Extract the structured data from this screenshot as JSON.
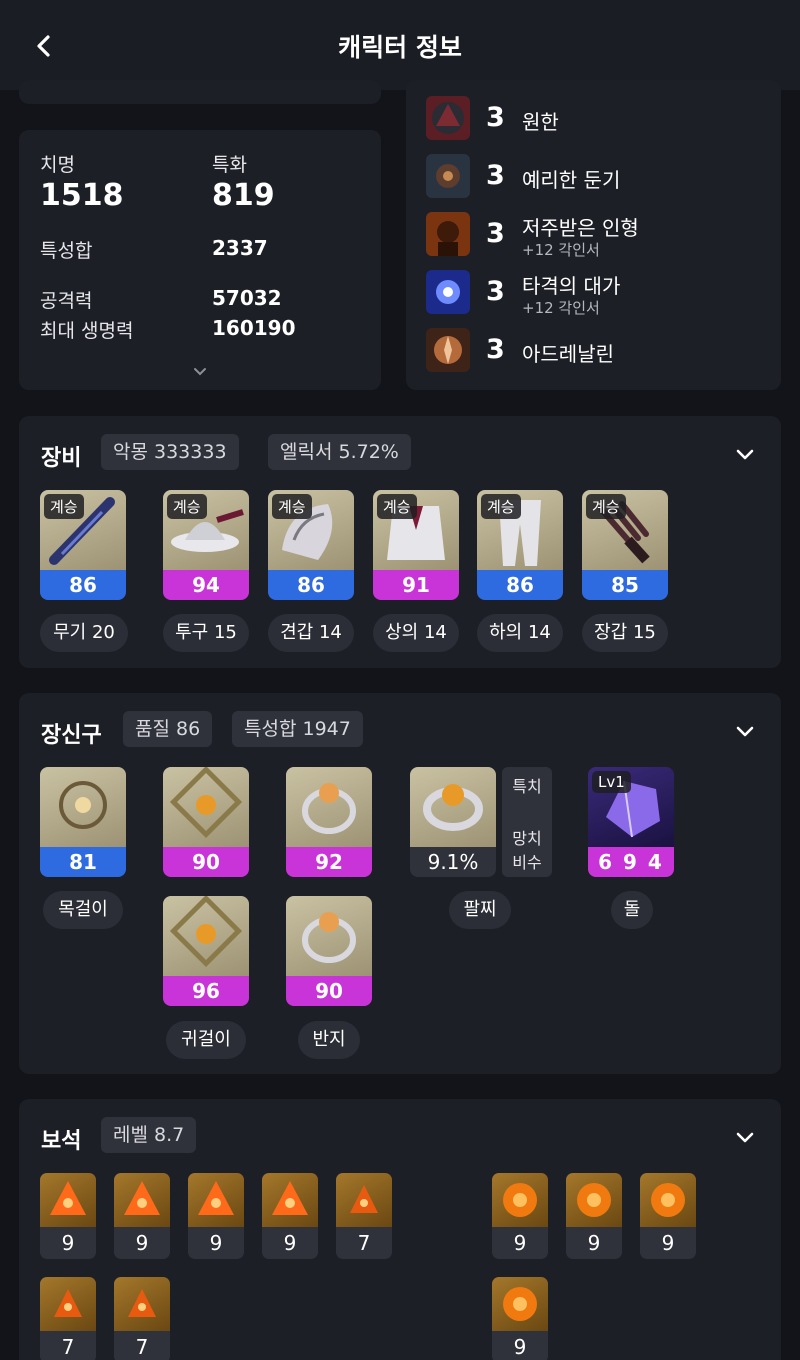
{
  "header": {
    "title": "캐릭터 정보"
  },
  "stats": {
    "crit_label": "치명",
    "crit_value": "1518",
    "spec_label": "특화",
    "spec_value": "819",
    "sum_label": "특성합",
    "sum_value": "2337",
    "atk_label": "공격력",
    "atk_value": "57032",
    "hp_label": "최대 생명력",
    "hp_value": "160190"
  },
  "engravings": [
    {
      "level": "3",
      "name": "원한",
      "sub": ""
    },
    {
      "level": "3",
      "name": "예리한 둔기",
      "sub": ""
    },
    {
      "level": "3",
      "name": "저주받은 인형",
      "sub": "+12 각인서"
    },
    {
      "level": "3",
      "name": "타격의 대가",
      "sub": "+12 각인서"
    },
    {
      "level": "3",
      "name": "아드레날린",
      "sub": ""
    }
  ],
  "equipment": {
    "title": "장비",
    "chip1": "악몽 333333",
    "chip2": "엘릭서 5.72%",
    "items": [
      {
        "tag": "계승",
        "quality": "86",
        "label": "무기 20"
      },
      {
        "tag": "계승",
        "quality": "94",
        "label": "투구 15"
      },
      {
        "tag": "계승",
        "quality": "86",
        "label": "견갑 14"
      },
      {
        "tag": "계승",
        "quality": "91",
        "label": "상의 14"
      },
      {
        "tag": "계승",
        "quality": "86",
        "label": "하의 14"
      },
      {
        "tag": "계승",
        "quality": "85",
        "label": "장갑 15"
      }
    ]
  },
  "accessories": {
    "title": "장신구",
    "chip1": "품질 86",
    "chip2": "특성합 1947",
    "necklace": {
      "quality": "81",
      "label": "목걸이"
    },
    "earring1": {
      "quality": "90"
    },
    "earring2": {
      "quality": "96"
    },
    "earring_label": "귀걸이",
    "ring1": {
      "quality": "92"
    },
    "ring2": {
      "quality": "90"
    },
    "ring_label": "반지",
    "bracelet": {
      "value": "9.1%",
      "label": "팔찌",
      "opt1": "특치",
      "opt2": "망치",
      "opt3": "비수"
    },
    "stone": {
      "tag": "Lv1",
      "value": "6 9 4",
      "label": "돌"
    }
  },
  "gems": {
    "title": "보석",
    "chip": "레벨 8.7",
    "left": [
      "9",
      "9",
      "9",
      "9",
      "7",
      "7",
      "7"
    ],
    "right": [
      "9",
      "9",
      "9",
      "9"
    ]
  },
  "colors": {
    "blue": "#2f6be0",
    "purple": "#c934d8",
    "bg": "#131419",
    "card": "#1d1f27"
  }
}
